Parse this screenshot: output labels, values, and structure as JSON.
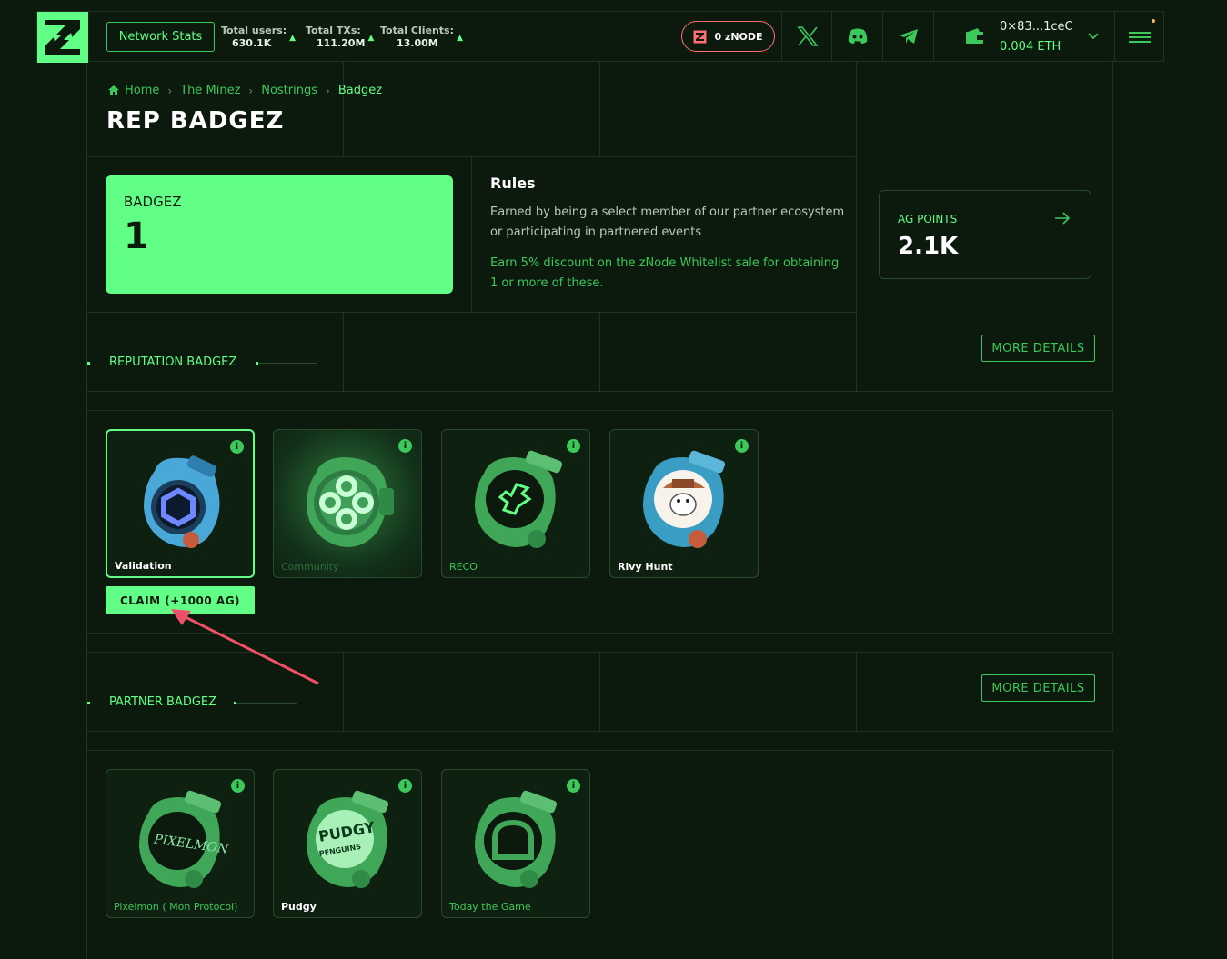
{
  "topbar": {
    "network_stats": "Network Stats",
    "stats": [
      {
        "label": "Total users:",
        "value": "630.1K"
      },
      {
        "label": "Total TXs:",
        "value": "111.20M"
      },
      {
        "label": "Total Clients:",
        "value": "13.00M"
      }
    ],
    "znode_label": "0 zNODE",
    "wallet_address": "0×83...1ceC",
    "wallet_balance": "0.004 ETH",
    "icons": [
      "x-icon",
      "discord-icon",
      "telegram-icon",
      "wallet-icon",
      "chevron-down-icon",
      "menu-icon"
    ]
  },
  "breadcrumb": [
    "Home",
    "The Minez",
    "Nostrings",
    "Badgez"
  ],
  "page_title": "REP BADGEZ",
  "badgez_card": {
    "label": "BADGEZ",
    "value": "1"
  },
  "rules": {
    "title": "Rules",
    "text": "Earned by being a select member of our partner ecosystem or participating in partnered events",
    "highlight": "Earn 5% discount on the zNode Whitelist sale for obtaining 1 or more of these."
  },
  "ag_points": {
    "label": "AG POINTS",
    "value": "2.1K"
  },
  "more_details": "MORE DETAILS",
  "reputation": {
    "title": "REPUTATION BADGEZ",
    "badges": [
      {
        "name": "Validation",
        "color": "#4aa8d8",
        "selected": true
      },
      {
        "name": "Community",
        "color": "#3fa757",
        "selected": false
      },
      {
        "name": "RECO",
        "color": "#3fa757",
        "selected": false
      },
      {
        "name": "Rivy Hunt",
        "color": "#3a9ec4",
        "selected": false
      }
    ],
    "claim_label": "CLAIM (+1000 AG)"
  },
  "partner": {
    "title": "PARTNER BADGEZ",
    "badges": [
      {
        "name": "Pixelmon ( Mon Protocol)"
      },
      {
        "name": "Pudgy"
      },
      {
        "name": "Today the Game"
      }
    ]
  },
  "colors": {
    "accent": "#62ff86",
    "bg": "#0b1a0d",
    "znode_border": "#ff6d75",
    "arrow": "#f2506a"
  }
}
